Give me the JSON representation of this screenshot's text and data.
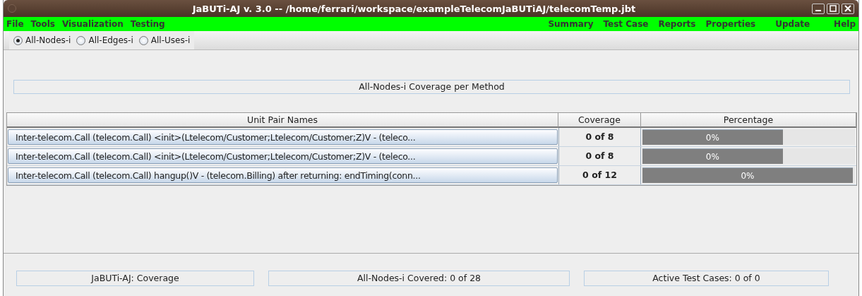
{
  "window": {
    "title": "JaBUTi-AJ v. 3.0 -- /home/ferrari/workspace/exampleTelecomJaBUTiAJ/telecomTemp.jbt"
  },
  "menu_left": [
    {
      "label": "File"
    },
    {
      "label": "Tools"
    },
    {
      "label": "Visualization"
    },
    {
      "label": "Testing"
    }
  ],
  "menu_right": [
    {
      "label": "Summary"
    },
    {
      "label": "Test Case"
    },
    {
      "label": "Reports"
    },
    {
      "label": "Properties"
    },
    {
      "label": "Update"
    },
    {
      "label": "Help"
    }
  ],
  "criteria": [
    {
      "label": "All-Nodes-i",
      "selected": true
    },
    {
      "label": "All-Edges-i",
      "selected": false
    },
    {
      "label": "All-Uses-i",
      "selected": false
    }
  ],
  "heading": "All-Nodes-i Coverage per Method",
  "table": {
    "columns": [
      "Unit Pair Names",
      "Coverage",
      "Percentage"
    ],
    "rows": [
      {
        "name": "Inter-telecom.Call (telecom.Call) <init>(Ltelecom/Customer;Ltelecom/Customer;Z)V - (teleco...",
        "coverage": "0 of 8",
        "percentage": "0%",
        "level": 0.66
      },
      {
        "name": "Inter-telecom.Call (telecom.Call) <init>(Ltelecom/Customer;Ltelecom/Customer;Z)V - (teleco...",
        "coverage": "0 of 8",
        "percentage": "0%",
        "level": 0.66
      },
      {
        "name": "Inter-telecom.Call (telecom.Call) hangup()V - (telecom.Billing) after returning: endTiming(conn...",
        "coverage": "0 of 12",
        "percentage": "0%",
        "level": 0.99
      }
    ]
  },
  "status_bar": [
    "JaBUTi-AJ: Coverage",
    "All-Nodes-i Covered: 0 of 28",
    "Active Test Cases: 0 of 0"
  ]
}
